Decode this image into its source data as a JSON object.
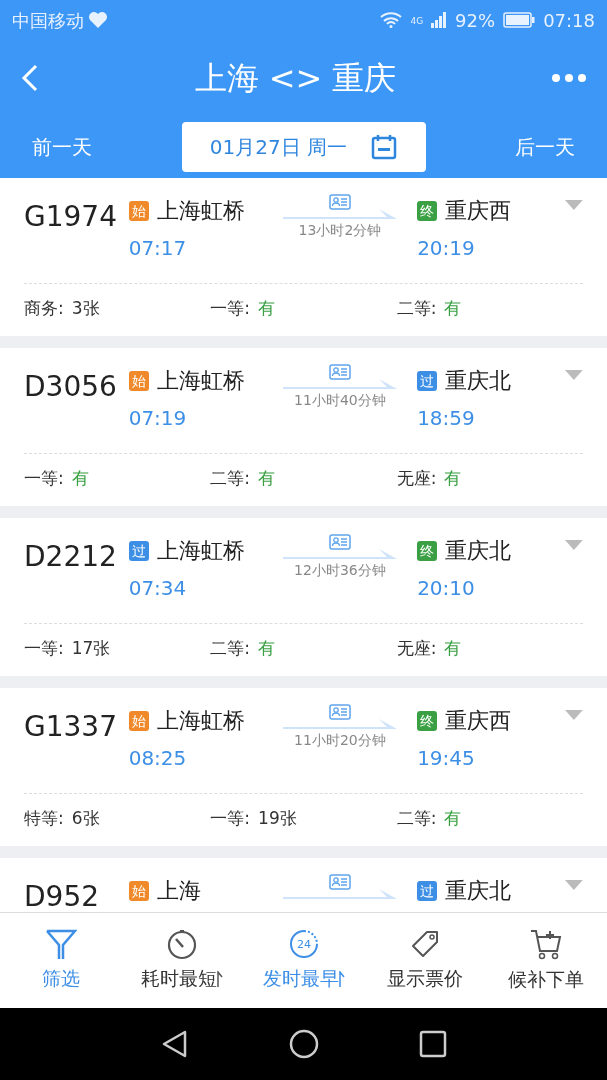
{
  "status_bar": {
    "carrier": "中国移动",
    "network": "4G",
    "battery": "92%",
    "time": "07:18"
  },
  "header": {
    "title": "上海 <> 重庆"
  },
  "date_bar": {
    "prev": "前一天",
    "date": "01月27日 周一",
    "next": "后一天"
  },
  "trains": [
    {
      "number": "G1974",
      "from": {
        "tag": "始",
        "color": "#f0892a",
        "station": "上海虹桥",
        "time": "07:17"
      },
      "duration": "13小时2分钟",
      "to": {
        "tag": "终",
        "color": "#3aa043",
        "station": "重庆西",
        "time": "20:19"
      },
      "seats": [
        {
          "label": "商务:",
          "value": "3张",
          "available": false
        },
        {
          "label": "一等:",
          "value": "有",
          "available": true
        },
        {
          "label": "二等:",
          "value": "有",
          "available": true
        }
      ]
    },
    {
      "number": "D3056",
      "from": {
        "tag": "始",
        "color": "#f0892a",
        "station": "上海虹桥",
        "time": "07:19"
      },
      "duration": "11小时40分钟",
      "to": {
        "tag": "过",
        "color": "#3d8fe6",
        "station": "重庆北",
        "time": "18:59"
      },
      "seats": [
        {
          "label": "一等:",
          "value": "有",
          "available": true
        },
        {
          "label": "二等:",
          "value": "有",
          "available": true
        },
        {
          "label": "无座:",
          "value": "有",
          "available": true
        }
      ]
    },
    {
      "number": "D2212",
      "from": {
        "tag": "过",
        "color": "#3d8fe6",
        "station": "上海虹桥",
        "time": "07:34"
      },
      "duration": "12小时36分钟",
      "to": {
        "tag": "终",
        "color": "#3aa043",
        "station": "重庆北",
        "time": "20:10"
      },
      "seats": [
        {
          "label": "一等:",
          "value": "17张",
          "available": false
        },
        {
          "label": "二等:",
          "value": "有",
          "available": true
        },
        {
          "label": "无座:",
          "value": "有",
          "available": true
        }
      ]
    },
    {
      "number": "G1337",
      "from": {
        "tag": "始",
        "color": "#f0892a",
        "station": "上海虹桥",
        "time": "08:25"
      },
      "duration": "11小时20分钟",
      "to": {
        "tag": "终",
        "color": "#3aa043",
        "station": "重庆西",
        "time": "19:45"
      },
      "seats": [
        {
          "label": "特等:",
          "value": "6张",
          "available": false
        },
        {
          "label": "一等:",
          "value": "19张",
          "available": false
        },
        {
          "label": "二等:",
          "value": "有",
          "available": true
        }
      ]
    },
    {
      "number": "D952",
      "from": {
        "tag": "始",
        "color": "#f0892a",
        "station": "上海"
      },
      "to": {
        "tag": "过",
        "color": "#3d8fe6",
        "station": "重庆北"
      }
    }
  ],
  "toolbar": [
    {
      "kind": "filter",
      "label": "筛选",
      "selected": true
    },
    {
      "kind": "duration",
      "label": "耗时最短",
      "selected": false
    },
    {
      "kind": "departure",
      "label": "发时最早",
      "selected": true,
      "icon_text": "24"
    },
    {
      "kind": "price",
      "label": "显示票价",
      "selected": false
    },
    {
      "kind": "waitlist",
      "label": "候补下单",
      "selected": false
    }
  ]
}
